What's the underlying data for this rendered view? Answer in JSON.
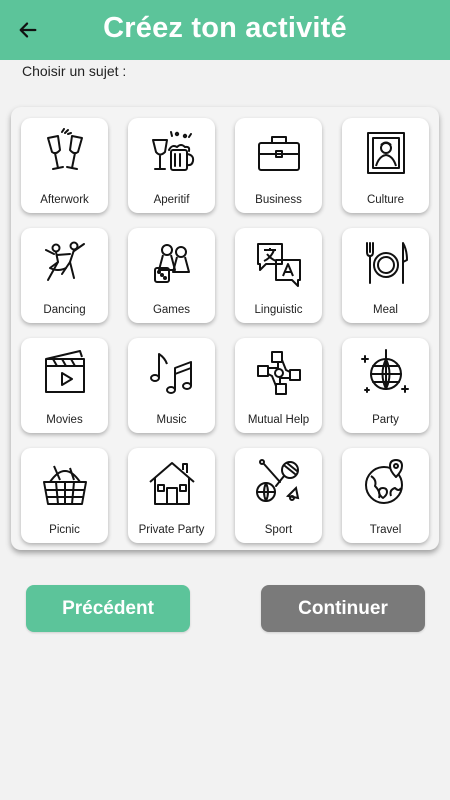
{
  "header": {
    "title": "Créez ton activité",
    "back_icon": "arrow-left-icon",
    "color": "#5cc49a"
  },
  "subject_label": "Choisir un sujet :",
  "subjects": [
    {
      "label": "Afterwork",
      "icon": "champagne-glasses-icon"
    },
    {
      "label": "Aperitif",
      "icon": "wine-and-beer-icon"
    },
    {
      "label": "Business",
      "icon": "briefcase-icon"
    },
    {
      "label": "Culture",
      "icon": "framed-painting-icon"
    },
    {
      "label": "Dancing",
      "icon": "dancing-couple-icon"
    },
    {
      "label": "Games",
      "icon": "board-game-pawns-icon"
    },
    {
      "label": "Linguistic",
      "icon": "translation-icon"
    },
    {
      "label": "Meal",
      "icon": "plate-fork-knife-icon"
    },
    {
      "label": "Movies",
      "icon": "clapperboard-icon"
    },
    {
      "label": "Music",
      "icon": "music-notes-icon"
    },
    {
      "label": "Mutual Help",
      "icon": "joined-hands-icon"
    },
    {
      "label": "Party",
      "icon": "disco-ball-icon"
    },
    {
      "label": "Picnic",
      "icon": "picnic-basket-icon"
    },
    {
      "label": "Private Party",
      "icon": "house-icon"
    },
    {
      "label": "Sport",
      "icon": "sports-equipment-icon"
    },
    {
      "label": "Travel",
      "icon": "globe-location-icon"
    }
  ],
  "buttons": {
    "previous": "Précédent",
    "continue": "Continuer",
    "previous_color": "#5cc49a",
    "continue_color": "#7a7a7a"
  }
}
